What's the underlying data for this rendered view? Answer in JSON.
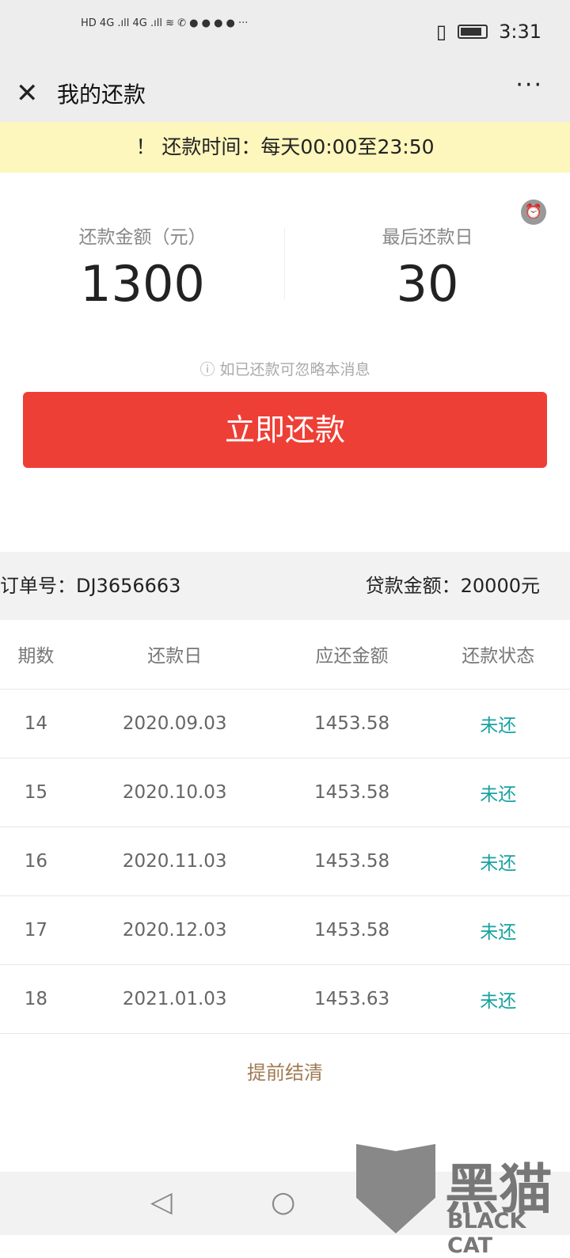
{
  "status_bar": {
    "time": "3:31",
    "icons": [
      "hd-icon",
      "signal-4g-icon",
      "signal-4g-icon",
      "wifi-icon",
      "missed-call-icon",
      "wechat-icon",
      "baidu-icon",
      "app-icon",
      "message-icon",
      "more-icon",
      "vibrate-icon",
      "battery-icon"
    ]
  },
  "header": {
    "title": "我的还款",
    "more": "···",
    "close": "✕"
  },
  "notice": "！ 还款时间：每天00:00至23:50",
  "summary": {
    "amount_label": "还款金额（元）",
    "amount": "1300",
    "due_label": "最后还款日",
    "due": "30"
  },
  "hint": "ⓘ 如已还款可忽略本消息",
  "pay_button": "立即还款",
  "order": {
    "order_no": "订单号：DJ3656663",
    "loan": "贷款金额：20000元"
  },
  "table": {
    "headers": [
      "期数",
      "还款日",
      "应还金额",
      "还款状态"
    ],
    "rows": [
      [
        "14",
        "2020.09.03",
        "1453.58",
        "未还"
      ],
      [
        "15",
        "2020.10.03",
        "1453.58",
        "未还"
      ],
      [
        "16",
        "2020.11.03",
        "1453.58",
        "未还"
      ],
      [
        "17",
        "2020.12.03",
        "1453.58",
        "未还"
      ],
      [
        "18",
        "2021.01.03",
        "1453.63",
        "未还"
      ]
    ]
  },
  "settle": "提前结清",
  "watermark": {
    "cn": "黑猫",
    "en": "BLACK CAT"
  },
  "colors": {
    "accent": "#ee3f36",
    "status": "#17a2a0",
    "notice_bg": "#fdf6bd"
  }
}
